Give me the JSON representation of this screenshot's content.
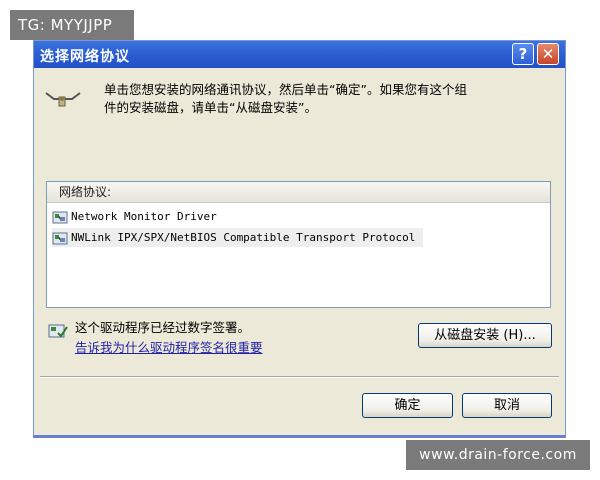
{
  "badge": {
    "text": "TG: MYYJJPP"
  },
  "dialog": {
    "title": "选择网络协议",
    "help_glyph": "?",
    "close_glyph": "✕",
    "instruction_line1": "单击您想安装的网络通讯协议，然后单击“确定”。如果您有这个组",
    "instruction_line2": "件的安装磁盘，请单击“从磁盘安装”。"
  },
  "protocol_list": {
    "header": "网络协议:",
    "items": [
      {
        "label": "Network Monitor Driver",
        "icon": "network-protocol-icon"
      },
      {
        "label": "NWLink IPX/SPX/NetBIOS Compatible Transport Protocol",
        "icon": "network-protocol-icon",
        "selected": true
      }
    ]
  },
  "signature": {
    "text": "这个驱动程序已经过数字签署。",
    "link": "告诉我为什么驱动程序签名很重要",
    "icon": "digital-signature-icon"
  },
  "buttons": {
    "from_disk": "从磁盘安装 (H)...",
    "ok": "确定",
    "cancel": "取消"
  },
  "watermark": {
    "text": "www.drain-force.com"
  },
  "colors": {
    "titlebar": "#2a5bd0",
    "dialog_bg": "#ece9d8",
    "link": "#2222a8",
    "badge_bg": "#7a7a7a"
  }
}
